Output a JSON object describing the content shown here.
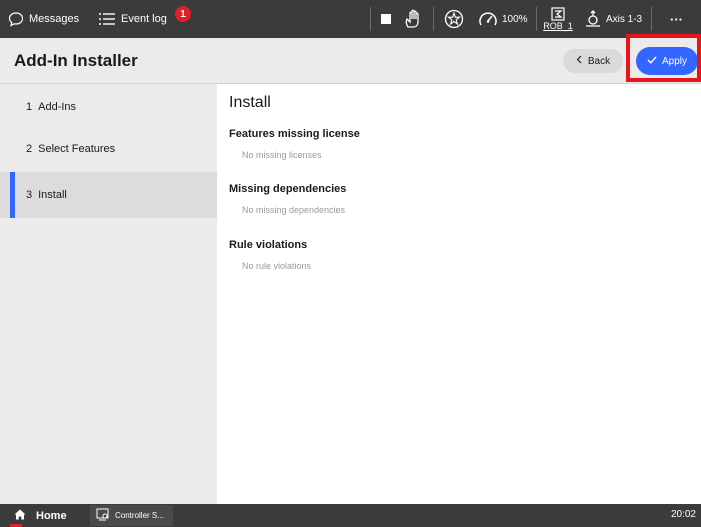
{
  "topbar": {
    "messages_label": "Messages",
    "eventlog_label": "Event log",
    "eventlog_badge": "1",
    "speed_label": "100%",
    "robot_label": "ROB_1",
    "axis_label": "Axis 1-3",
    "more_label": "···"
  },
  "header": {
    "title": "Add-In Installer",
    "back_label": "Back",
    "apply_label": "Apply"
  },
  "sidebar": {
    "steps": [
      {
        "num": "1",
        "label": "Add-Ins",
        "active": false
      },
      {
        "num": "2",
        "label": "Select Features",
        "active": false
      },
      {
        "num": "3",
        "label": "Install",
        "active": true
      }
    ]
  },
  "main": {
    "title": "Install",
    "sections": [
      {
        "heading": "Features missing license",
        "value": "No missing licenses"
      },
      {
        "heading": "Missing dependencies",
        "value": "No missing dependencies"
      },
      {
        "heading": "Rule violations",
        "value": "No rule violations"
      }
    ]
  },
  "bottombar": {
    "home_label": "Home",
    "task_label": "Controller S...",
    "clock": "20:02"
  },
  "colors": {
    "accent": "#3366ff",
    "alert": "#e01f26",
    "topbar": "#3b3b3b"
  }
}
